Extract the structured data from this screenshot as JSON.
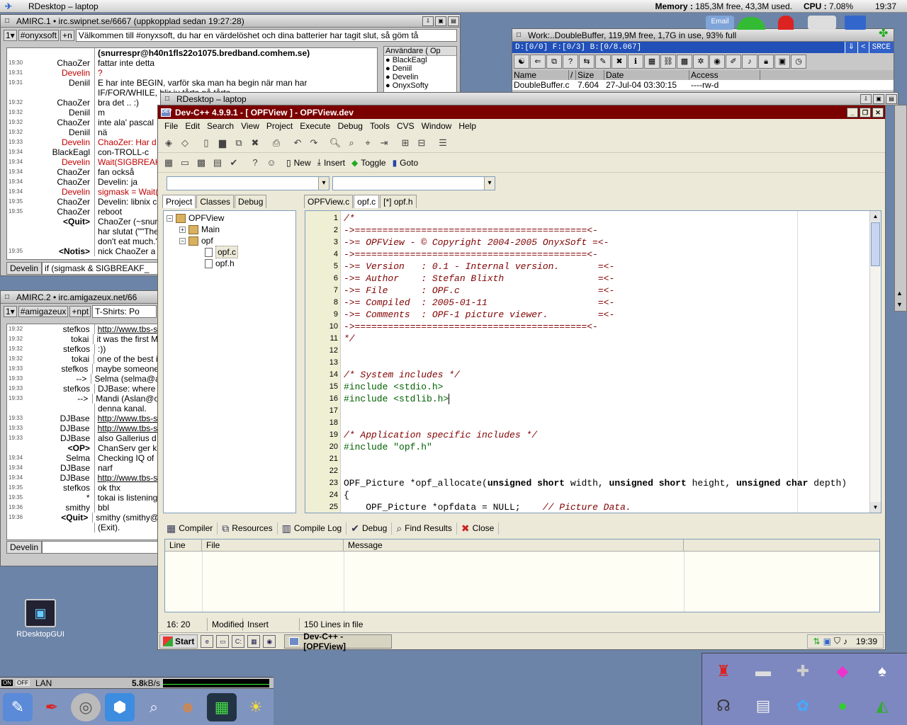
{
  "screen": {
    "title": "RDesktop – laptop",
    "memory_label": "Memory :",
    "memory_value": "185,3M free, 43,3M used.",
    "cpu_label": "CPU :",
    "cpu_value": "7.08%",
    "clock": "19:37"
  },
  "irc1": {
    "title": "AMIRC.1 • irc.swipnet.se/6667 (uppkopplad sedan 19:27:28)",
    "channel": "#onyxsoft",
    "mode": "+n",
    "topic": "Välkommen till #onyxsoft, du har en värdelöshet och dina batterier har tagit slut, så göm tå",
    "users_header": "Användare ( ",
    "users_op": "Op",
    "users": [
      "BlackEagl",
      "Deniil",
      "Develin",
      "OnyxSofty"
    ],
    "messages": [
      {
        "ts": "",
        "nick": "",
        "text": "(snurrespr@h40n1fls22o1075.bredband.comhem.se)",
        "bold": true
      },
      {
        "ts": "19:30",
        "nick": "ChaoZer",
        "text": "fattar inte detta"
      },
      {
        "ts": "19:31",
        "nick": "Develin",
        "text": "?",
        "red": true
      },
      {
        "ts": "19:31",
        "nick": "Deniil",
        "text": "E har inte BEGIN, varför ska man ha begin när man har"
      },
      {
        "ts": "",
        "nick": "",
        "text": "IF/FOR/WHILE, blir ju tårta på tårta"
      },
      {
        "ts": "19:32",
        "nick": "ChaoZer",
        "text": "bra det .. :)"
      },
      {
        "ts": "19:32",
        "nick": "Deniil",
        "text": "m"
      },
      {
        "ts": "19:32",
        "nick": "ChaoZer",
        "text": "inte ala' pascal"
      },
      {
        "ts": "19:32",
        "nick": "Deniil",
        "text": "nä"
      },
      {
        "ts": "19:33",
        "nick": "Develin",
        "text": "ChaoZer: Har d",
        "red": true
      },
      {
        "ts": "19:34",
        "nick": "BlackEagl",
        "text": "con-TROLL-c"
      },
      {
        "ts": "19:34",
        "nick": "Develin",
        "text": "Wait(SIGBREAK",
        "red": true
      },
      {
        "ts": "19:34",
        "nick": "ChaoZer",
        "text": "fan också"
      },
      {
        "ts": "19:34",
        "nick": "ChaoZer",
        "text": "Develin: ja"
      },
      {
        "ts": "19:34",
        "nick": "Develin",
        "text": "sigmask = Wait(",
        "red": true
      },
      {
        "ts": "19:35",
        "nick": "ChaoZer",
        "text": "Develin: libnix c"
      },
      {
        "ts": "19:35",
        "nick": "ChaoZer",
        "text": "reboot"
      },
      {
        "ts": "",
        "nick": "<Quit>",
        "text": "ChaoZer (~snur",
        "bold_nick": true
      },
      {
        "ts": "",
        "nick": "",
        "text": "har slutat (\"\"The"
      },
      {
        "ts": "",
        "nick": "",
        "text": "don't eat much.\""
      },
      {
        "ts": "19:35",
        "nick": "<Notis>",
        "text": "nick ChaoZer a",
        "bold_nick": true
      }
    ],
    "input_nick": "Develin",
    "input_text": "if (sigmask & SIGBREAKF_"
  },
  "irc2": {
    "title": "AMIRC.2 • irc.amigazeux.net/66",
    "channel": "#amigazeux",
    "mode": "+npt",
    "topic": "T-Shirts: Po",
    "messages": [
      {
        "ts": "19:32",
        "nick": "stefkos",
        "text": "http://www.tbs-s",
        "link": true
      },
      {
        "ts": "19:32",
        "nick": "tokai",
        "text": "it was the first M"
      },
      {
        "ts": "19:32",
        "nick": "stefkos",
        "text": ":))"
      },
      {
        "ts": "19:32",
        "nick": "tokai",
        "text": "one of the best i"
      },
      {
        "ts": "19:33",
        "nick": "stefkos",
        "text": "maybe someone"
      },
      {
        "ts": "19:33",
        "nick": "-->",
        "text": "Selma (selma@a"
      },
      {
        "ts": "19:33",
        "nick": "stefkos",
        "text": "DJBase: where"
      },
      {
        "ts": "19:33",
        "nick": "-->",
        "text": "Mandi (Aslan@o"
      },
      {
        "ts": "",
        "nick": "",
        "text": "denna kanal."
      },
      {
        "ts": "19:33",
        "nick": "DJBase",
        "text": "http://www.tbs-s",
        "link": true
      },
      {
        "ts": "19:33",
        "nick": "DJBase",
        "text": "http://www.tbs-s",
        "link": true
      },
      {
        "ts": "19:33",
        "nick": "DJBase",
        "text": "also Gallerius d"
      },
      {
        "ts": "",
        "nick": "<OP>",
        "text": "ChanServ ger k",
        "bold_nick": true
      },
      {
        "ts": "19:34",
        "nick": "Selma",
        "text": "Checking IQ of"
      },
      {
        "ts": "19:34",
        "nick": "DJBase",
        "text": "narf"
      },
      {
        "ts": "19:34",
        "nick": "DJBase",
        "text": "http://www.tbs-s",
        "link": true
      },
      {
        "ts": "19:35",
        "nick": "stefkos",
        "text": "ok thx"
      },
      {
        "ts": "19:35",
        "nick": "*",
        "text": "tokai is listening"
      },
      {
        "ts": "19:36",
        "nick": "smithy",
        "text": "bbl"
      },
      {
        "ts": "19:36",
        "nick": "<Quit>",
        "text": "smithy (smithy@",
        "bold_nick": true
      },
      {
        "ts": "",
        "nick": "",
        "text": "(Exit)."
      }
    ],
    "input_nick": "Develin",
    "input_text": ""
  },
  "dopus": {
    "title": "Work:..DoubleBuffer,  119,9M free, 1,7G in use, 93% full",
    "path": "D:[0/0] F:[0/3] B:[0/8.067]",
    "btn_up": "⇓",
    "btn_back": "<",
    "btn_src": "SRCE",
    "headers": [
      "Name",
      "/",
      "Size",
      "Date",
      "Access"
    ],
    "row": {
      "name": "DoubleBuffer.c",
      "size": "7.604",
      "date": "27-Jul-04 03:30:15",
      "access": "----rw-d"
    }
  },
  "rdesk_title": "RDesktop – laptop",
  "devcpp": {
    "title": "Dev-C++ 4.9.9.1  - [ OPFView ] - OPFView.dev",
    "menu": [
      "File",
      "Edit",
      "Search",
      "View",
      "Project",
      "Execute",
      "Debug",
      "Tools",
      "CVS",
      "Window",
      "Help"
    ],
    "labels": {
      "new": "New",
      "insert": "Insert",
      "toggle": "Toggle",
      "goto": "Goto"
    },
    "left_tabs": [
      "Project",
      "Classes",
      "Debug"
    ],
    "tree": {
      "root": "OPFView",
      "main": "Main",
      "opf": "opf",
      "file1": "opf.c",
      "file2": "opf.h"
    },
    "editor_tabs": [
      "OPFView.c",
      "opf.c",
      "[*] opf.h"
    ],
    "bottom_tabs": [
      "Compiler",
      "Resources",
      "Compile Log",
      "Debug",
      "Find Results",
      "Close"
    ],
    "msg_headers": [
      "Line",
      "File",
      "Message"
    ],
    "status": {
      "pos": "16: 20",
      "modified": "Modified",
      "mode": "Insert",
      "lines": "150 Lines in file"
    },
    "code_lines": [
      "/*",
      "->==========================================<-",
      "->= OPFView - © Copyright 2004-2005 OnyxSoft =<-",
      "->==========================================<-",
      "->= Version   : 0.1 - Internal version.       =<-",
      "->= Author    : Stefan Blixth                 =<-",
      "->= File      : OPF.c                         =<-",
      "->= Compiled  : 2005-01-11                    =<-",
      "->= Comments  : OPF-1 picture viewer.         =<-",
      "->==========================================<-",
      "*/",
      "",
      "",
      "/* System includes */",
      "#include <stdio.h>",
      "#include <stdlib.h>",
      "",
      "",
      "/* Application specific includes */",
      "#include \"opf.h\"",
      "",
      "",
      "OPF_Picture *opf_allocate(unsigned short width, unsigned short height, unsigned char depth)",
      "{",
      "    OPF_Picture *opfdata = NULL;    // Picture Data."
    ]
  },
  "rtaskbar": {
    "start": "Start",
    "task": "Dev-C++ - [OPFView]",
    "clock": "19:39"
  },
  "desktop_icon": "RDesktopGUI",
  "dock": {
    "net": "LAN",
    "rate": "5.8",
    "rate_unit": "kB/s",
    "on": "ON",
    "off": "OFF"
  },
  "top_right_icon_label": "Email"
}
